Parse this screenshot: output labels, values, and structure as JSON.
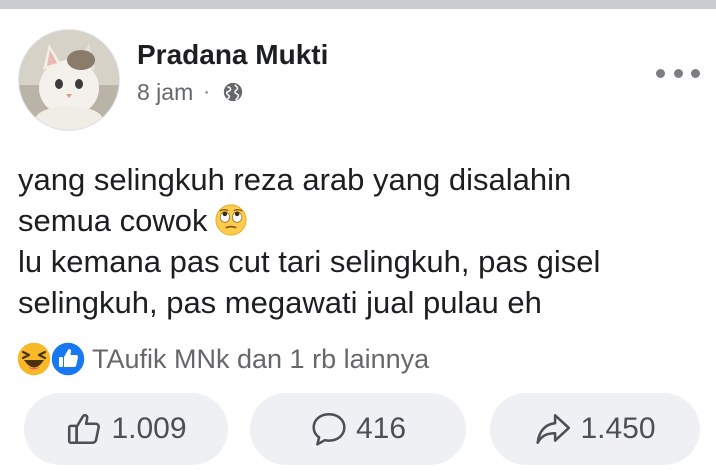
{
  "post": {
    "author": "Pradana Mukti",
    "time": "8 jam",
    "separator": "·",
    "privacy_icon": "globe-icon",
    "more_icon": "more-options-icon",
    "text_lines": [
      "yang selingkuh reza arab yang disalahin",
      "semua cowok",
      "lu kemana pas cut tari selingkuh, pas gisel",
      "selingkuh, pas megawati jual pulau eh"
    ],
    "inline_emoji": "face-with-rolling-eyes-emoji"
  },
  "reactions": {
    "icons": [
      "haha-reaction-icon",
      "like-reaction-icon"
    ],
    "summary": "TAufik MNk dan 1 rb lainnya"
  },
  "actions": {
    "like_count": "1.009",
    "comment_count": "416",
    "share_count": "1.450"
  },
  "colors": {
    "like_blue": "#1877f2",
    "haha_yellow": "#f7b928",
    "secondary_text": "#65676b",
    "button_bg": "#eef0f3"
  }
}
